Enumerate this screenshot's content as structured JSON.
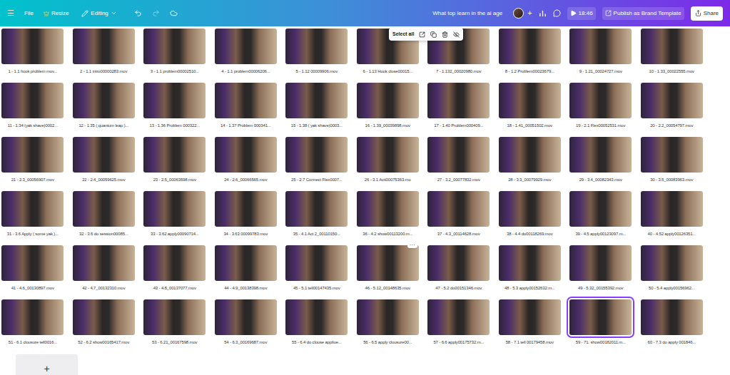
{
  "topbar": {
    "menu": "☰",
    "file": "File",
    "resize": "Resize",
    "mode": "Editing",
    "title": "What top learn in the ai age",
    "add": "+",
    "play_time": "18:46",
    "publish": "Publish as Brand Template",
    "share": "Share"
  },
  "floating_toolbar": {
    "select_all": "Select all"
  },
  "page_menu": "···",
  "add_page": "+",
  "pages": [
    {
      "label": "1 - 1.1 hook problem mov...",
      "selected": false,
      "hovered": false
    },
    {
      "label": "2 - 1.1 intro00000283.mov",
      "selected": false,
      "hovered": false
    },
    {
      "label": "3 - 1.1 problem00002510...",
      "selected": false,
      "hovered": false
    },
    {
      "label": "4 - 1.1 problem00006206...",
      "selected": false,
      "hovered": false
    },
    {
      "label": "5 - 1.12 00009906.mov",
      "selected": false,
      "hovered": false
    },
    {
      "label": "6 - 1.13 Hook close00015...",
      "selected": false,
      "hovered": false
    },
    {
      "label": "7 - 1.132_00020980.mov",
      "selected": false,
      "hovered": false
    },
    {
      "label": "8 - 1.2 Problem00023679...",
      "selected": false,
      "hovered": false
    },
    {
      "label": "9 - 1.21_00024727.mov",
      "selected": false,
      "hovered": false
    },
    {
      "label": "10 - 1.33_00022555.mov",
      "selected": false,
      "hovered": false
    },
    {
      "label": "11 - 1.34 (yak shave)0002...",
      "selected": false,
      "hovered": false
    },
    {
      "label": "12 - 1.35 ( quantum leap )...",
      "selected": false,
      "hovered": false
    },
    {
      "label": "13 - 1.36 Problem 000322...",
      "selected": false,
      "hovered": false
    },
    {
      "label": "14 - 1.37 Problem 000341...",
      "selected": false,
      "hovered": false
    },
    {
      "label": "15 - 1.38 ( yak shave)0003...",
      "selected": false,
      "hovered": false
    },
    {
      "label": "16 - 1.39_00039898.mov",
      "selected": false,
      "hovered": false
    },
    {
      "label": "17 - 1.40 Problem000409...",
      "selected": false,
      "hovered": false
    },
    {
      "label": "18 - 1.41_00051502.mov",
      "selected": false,
      "hovered": false
    },
    {
      "label": "19 - 2.1 Flex00052531.mov",
      "selected": false,
      "hovered": false
    },
    {
      "label": "20 - 2.2_00054797.mov",
      "selected": false,
      "hovered": false
    },
    {
      "label": "21 - 2.3_00056907.mov",
      "selected": false,
      "hovered": false
    },
    {
      "label": "22 - 2.4_00059625.mov",
      "selected": false,
      "hovered": false
    },
    {
      "label": "23 - 2.5_00063598.mov",
      "selected": false,
      "hovered": false
    },
    {
      "label": "24 - 2.6_00066565.mov",
      "selected": false,
      "hovered": false
    },
    {
      "label": "25 - 2.7 Connect Flex0007...",
      "selected": false,
      "hovered": false
    },
    {
      "label": "26 - 3.1 Acti00075363.mo",
      "selected": false,
      "hovered": false
    },
    {
      "label": "27 - 3.2_00077832.mov",
      "selected": false,
      "hovered": false
    },
    {
      "label": "28 - 3.3_00079929.mov",
      "selected": false,
      "hovered": false
    },
    {
      "label": "29 - 3.4_00082343.mov",
      "selected": false,
      "hovered": false
    },
    {
      "label": "30 - 3.5_00083963.mov",
      "selected": false,
      "hovered": false
    },
    {
      "label": "31 - 3.6 Apply ( some yak )...",
      "selected": false,
      "hovered": false
    },
    {
      "label": "32 - 3.6 do session00085...",
      "selected": false,
      "hovered": false
    },
    {
      "label": "33 - 3.62 apply00090714...",
      "selected": false,
      "hovered": false
    },
    {
      "label": "34 - 3.63 00099783.mov",
      "selected": false,
      "hovered": false
    },
    {
      "label": "35 - 4.1 Act 2_00110150...",
      "selected": false,
      "hovered": false
    },
    {
      "label": "36 - 4.2 show00113200.m...",
      "selected": false,
      "hovered": false
    },
    {
      "label": "37 - 4.3_00114628.mov",
      "selected": false,
      "hovered": false
    },
    {
      "label": "38 - 4.4 do00118269.mov",
      "selected": false,
      "hovered": false
    },
    {
      "label": "39 - 4.5 apply00123097.m...",
      "selected": false,
      "hovered": false
    },
    {
      "label": "40 - 4.52 apply00126351...",
      "selected": false,
      "hovered": false
    },
    {
      "label": "41 - 4.6_00130897.mov",
      "selected": false,
      "hovered": false
    },
    {
      "label": "42 - 4.7_00132310.mov",
      "selected": false,
      "hovered": false
    },
    {
      "label": "43 - 4.8_00137077.mov",
      "selected": false,
      "hovered": false
    },
    {
      "label": "44 - 4.9_00138398.mov",
      "selected": false,
      "hovered": false
    },
    {
      "label": "45 - 5.1 tell00147435.mov",
      "selected": false,
      "hovered": false
    },
    {
      "label": "46 - 5.12_00148635.mov",
      "selected": false,
      "hovered": true
    },
    {
      "label": "47 - 5.2 do00151346.mov",
      "selected": false,
      "hovered": false
    },
    {
      "label": "48 - 5.3 apply00152632.m...",
      "selected": false,
      "hovered": false
    },
    {
      "label": "49 - 5.32_00155392.mov",
      "selected": false,
      "hovered": false
    },
    {
      "label": "50 - 5.4 apply00156962...",
      "selected": false,
      "hovered": false
    },
    {
      "label": "51 - 6.1 clousure tell0016...",
      "selected": false,
      "hovered": false
    },
    {
      "label": "52 - 6.2 show00165417.mov",
      "selected": false,
      "hovered": false
    },
    {
      "label": "53 - 6.21_00167598.mov",
      "selected": false,
      "hovered": false
    },
    {
      "label": "54 - 6.3_00169687.mov",
      "selected": false,
      "hovered": false
    },
    {
      "label": "55 - 6.4 do clouse appliue...",
      "selected": false,
      "hovered": false
    },
    {
      "label": "56 - 6.5 apply clousure00...",
      "selected": false,
      "hovered": false
    },
    {
      "label": "57 - 6.6 apply00175732.m...",
      "selected": false,
      "hovered": false
    },
    {
      "label": "58 - 7.1 tell 00179458.mov",
      "selected": false,
      "hovered": false
    },
    {
      "label": "59 - 71. show00182011.m...",
      "selected": true,
      "hovered": false
    },
    {
      "label": "60 - 7.3 do apply 001846...",
      "selected": false,
      "hovered": false
    }
  ]
}
